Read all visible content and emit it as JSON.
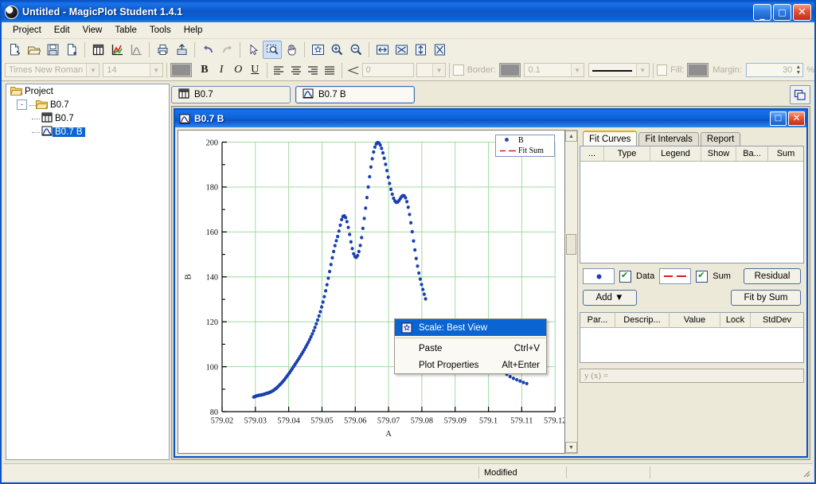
{
  "window": {
    "title": "Untitled - MagicPlot Student 1.4.1",
    "icon": "magicplot-logo-icon",
    "minimize": "_",
    "maximize": "□",
    "close": "✕"
  },
  "menubar": {
    "items": [
      "Project",
      "Edit",
      "View",
      "Table",
      "Tools",
      "Help"
    ]
  },
  "toolbar_main": {
    "groups": [
      [
        {
          "name": "new-project-icon",
          "title": "New Project"
        },
        {
          "name": "open-project-icon",
          "title": "Open Project"
        },
        {
          "name": "save-project-icon",
          "title": "Save Project"
        },
        {
          "name": "new-table-icon",
          "title": "New Table"
        }
      ],
      [
        {
          "name": "table-icon",
          "title": "Table"
        },
        {
          "name": "figure-icon",
          "title": "Figure"
        },
        {
          "name": "fit-plot-icon",
          "title": "Fit Plot"
        }
      ],
      [
        {
          "name": "print-icon",
          "title": "Print"
        },
        {
          "name": "export-icon",
          "title": "Export"
        }
      ],
      [
        {
          "name": "undo-icon",
          "title": "Undo"
        },
        {
          "name": "redo-icon",
          "title": "Redo"
        }
      ],
      [
        {
          "name": "select-arrow-icon",
          "title": "Select"
        },
        {
          "name": "zoom-select-icon",
          "title": "Zoom Select",
          "selected": true
        },
        {
          "name": "pan-hand-icon",
          "title": "Pan"
        }
      ],
      [
        {
          "name": "fit-best-view-icon",
          "title": "Scale: Best View"
        },
        {
          "name": "zoom-in-icon",
          "title": "Zoom In"
        },
        {
          "name": "zoom-out-icon",
          "title": "Zoom Out"
        }
      ],
      [
        {
          "name": "fit-width-icon",
          "title": "Fit Width"
        },
        {
          "name": "shrink-width-icon",
          "title": "Shrink Width"
        },
        {
          "name": "fit-height-icon",
          "title": "Fit Height"
        },
        {
          "name": "shrink-height-icon",
          "title": "Shrink Height"
        }
      ]
    ]
  },
  "toolbar_format": {
    "font_family": "Times New Roman",
    "font_size": "14",
    "color_swatch": "#8f8f8f",
    "bold": "B",
    "italic": "I",
    "outline": "O",
    "underline": "U",
    "align_left": "align-left-icon",
    "align_center": "align-center-icon",
    "align_right": "align-right-icon",
    "align_justify": "align-justify-icon",
    "angle_icon": "angle-icon",
    "angle_value": "0",
    "border_label": "Border:",
    "border_color": "#8f8f8f",
    "border_width": "0.1",
    "line_style": "solid-line",
    "fill_label": "Fill:",
    "fill_color": "#8f8f8f",
    "margin_label": "Margin:",
    "margin_value": "30",
    "percent": "%"
  },
  "tree": {
    "root": {
      "label": "Project",
      "icon": "folder-icon"
    },
    "folder": {
      "label": "B0.7",
      "icon": "folder-icon",
      "expander": "-"
    },
    "children": [
      {
        "label": "B0.7",
        "icon": "table-icon",
        "selected": false
      },
      {
        "label": "B0.7 B",
        "icon": "fit-plot-icon",
        "selected": true
      }
    ]
  },
  "doc_tabs": {
    "items": [
      {
        "label": "B0.7",
        "icon": "table-icon",
        "active": false
      },
      {
        "label": "B0.7 B",
        "icon": "fit-plot-icon",
        "active": true
      }
    ],
    "cascade_icon": "cascade-windows-icon"
  },
  "child_window": {
    "title": "B0.7 B",
    "icon": "fit-plot-icon",
    "maximize": "□",
    "close": "✕"
  },
  "context_menu": {
    "items": [
      {
        "label": "Scale: Best View",
        "shortcut": "",
        "highlighted": true,
        "icon": "best-view-icon"
      },
      {
        "label": "Paste",
        "shortcut": "Ctrl+V",
        "highlighted": false
      },
      {
        "label": "Plot Properties",
        "shortcut": "Alt+Enter",
        "highlighted": false
      }
    ]
  },
  "fit_panel": {
    "tabs": [
      {
        "label": "Fit Curves",
        "active": true
      },
      {
        "label": "Fit Intervals",
        "active": false
      },
      {
        "label": "Report",
        "active": false
      }
    ],
    "curves_columns": [
      "...",
      "Type",
      "Legend",
      "Show",
      "Ba...",
      "Sum"
    ],
    "curves_rows": [],
    "controls": {
      "data_style": "blue-dot-marker",
      "data_label": "Data",
      "data_checked": true,
      "sum_style": "red-dashed-line",
      "sum_label": "Sum",
      "sum_checked": true,
      "residual_button": "Residual",
      "add_button": "Add ▼",
      "fit_by_sum_button": "Fit by Sum"
    },
    "params_columns": [
      "Par...",
      "Descrip...",
      "Value",
      "Lock",
      "StdDev"
    ],
    "params_rows": [],
    "formula_placeholder": "y (x) ="
  },
  "status_bar": {
    "left": "",
    "message": "Modified",
    "cell2": "",
    "cell3": ""
  },
  "chart_data": {
    "type": "scatter",
    "title": "",
    "xlabel": "A",
    "ylabel": "B",
    "xlim": [
      579.02,
      579.12
    ],
    "xticks": [
      "579.02",
      "579.03",
      "579.04",
      "579.05",
      "579.06",
      "579.07",
      "579.08",
      "579.09",
      "579.1",
      "579.11",
      "579.12"
    ],
    "ylim": [
      80,
      200
    ],
    "yticks": [
      "80",
      "100",
      "120",
      "140",
      "160",
      "180",
      "200"
    ],
    "ytick_minor_step": 10,
    "grid": true,
    "grid_color": "#9fdba0",
    "legend_position": "top-right",
    "legend": [
      {
        "name": "B",
        "style": "dot",
        "color": "#1a3fb0"
      },
      {
        "name": "Fit Sum",
        "style": "dashed",
        "color": "#e01b1b"
      }
    ],
    "marker_color": "#1a3fb0",
    "series": [
      {
        "name": "B",
        "x": [
          579.0295,
          579.0299,
          579.0303,
          579.0307,
          579.0311,
          579.0315,
          579.0319,
          579.0323,
          579.0327,
          579.0331,
          579.0335,
          579.0339,
          579.0343,
          579.0347,
          579.0351,
          579.0355,
          579.0359,
          579.0363,
          579.0367,
          579.0371,
          579.0375,
          579.0379,
          579.0383,
          579.0387,
          579.0391,
          579.0395,
          579.0399,
          579.0403,
          579.0407,
          579.0411,
          579.0415,
          579.0419,
          579.0423,
          579.0427,
          579.0431,
          579.0435,
          579.0439,
          579.0443,
          579.0447,
          579.0451,
          579.0455,
          579.0459,
          579.0463,
          579.0467,
          579.0471,
          579.0475,
          579.0479,
          579.0483,
          579.0487,
          579.0491,
          579.0495,
          579.0499,
          579.0503,
          579.0507,
          579.0511,
          579.0515,
          579.0519,
          579.0523,
          579.0527,
          579.0531,
          579.0535,
          579.0539,
          579.0543,
          579.0547,
          579.0551,
          579.0555,
          579.0559,
          579.0563,
          579.0567,
          579.0571,
          579.0575,
          579.0579,
          579.0583,
          579.0587,
          579.0591,
          579.0595,
          579.0599,
          579.0603,
          579.0607,
          579.0611,
          579.0615,
          579.0619,
          579.0623,
          579.0627,
          579.0631,
          579.0635,
          579.0639,
          579.0643,
          579.0647,
          579.0651,
          579.0655,
          579.0659,
          579.0663,
          579.0667,
          579.0671,
          579.0675,
          579.0679,
          579.0683,
          579.0687,
          579.0691,
          579.0695,
          579.0699,
          579.0703,
          579.0707,
          579.0711,
          579.0715,
          579.0719,
          579.0723,
          579.0727,
          579.0731,
          579.0735,
          579.0739,
          579.0743,
          579.0747,
          579.0751,
          579.0755,
          579.0759,
          579.0763,
          579.0767,
          579.0771,
          579.0775,
          579.0779,
          579.0783,
          579.0787,
          579.0791,
          579.0795,
          579.0799,
          579.0803,
          579.0807,
          579.0811,
          579.1055,
          579.1065,
          579.1075,
          579.1085,
          579.1095,
          579.1105,
          579.1115
        ],
        "y": [
          86.5,
          86.7,
          87.0,
          87.1,
          87.3,
          87.3,
          87.5,
          87.6,
          87.8,
          88.0,
          88.2,
          88.3,
          88.6,
          88.8,
          89.2,
          89.5,
          90.0,
          90.4,
          91.0,
          91.6,
          92.2,
          92.8,
          93.5,
          94.2,
          95.0,
          95.8,
          96.6,
          97.4,
          98.3,
          99.2,
          100.1,
          101.0,
          101.9,
          102.8,
          103.7,
          104.7,
          105.6,
          106.6,
          107.6,
          108.7,
          109.8,
          110.9,
          112.1,
          113.3,
          114.6,
          116.0,
          117.5,
          119.1,
          120.8,
          122.6,
          124.5,
          126.6,
          128.8,
          131.2,
          133.8,
          136.5,
          139.4,
          142.4,
          145.5,
          148.5,
          151.3,
          153.9,
          156.1,
          158.0,
          160.4,
          163.0,
          165.5,
          166.9,
          167.2,
          166.4,
          164.6,
          162.0,
          158.9,
          155.6,
          152.6,
          150.3,
          149.0,
          148.7,
          149.5,
          151.3,
          154.0,
          157.5,
          161.6,
          166.0,
          170.6,
          175.3,
          180.0,
          184.6,
          188.9,
          192.6,
          195.6,
          197.8,
          199.2,
          199.8,
          199.6,
          198.7,
          197.2,
          195.2,
          192.8,
          190.1,
          187.3,
          184.4,
          181.6,
          179.0,
          176.8,
          175.0,
          173.8,
          173.2,
          173.3,
          173.9,
          174.8,
          175.7,
          176.2,
          176.1,
          175.2,
          173.5,
          171.0,
          167.8,
          164.1,
          160.1,
          156.0,
          152.0,
          148.2,
          144.8,
          141.7,
          139.0,
          136.6,
          134.4,
          132.3,
          130.2,
          96.6,
          95.6,
          94.8,
          94.2,
          93.6,
          93.0,
          92.5
        ]
      }
    ]
  }
}
